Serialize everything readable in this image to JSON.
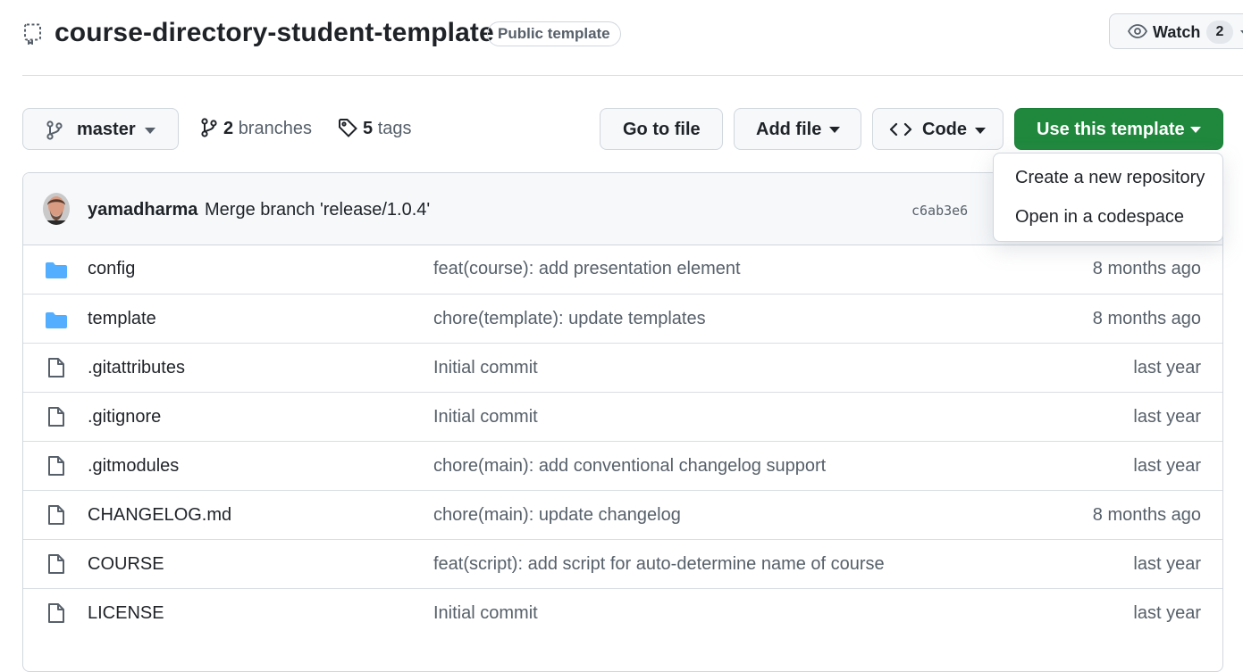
{
  "header": {
    "repo_name": "course-directory-student-template",
    "visibility_badge": "Public template",
    "watch_label": "Watch",
    "watch_count": "2"
  },
  "toolbar": {
    "branch": "master",
    "branches_count": "2",
    "branches_label": "branches",
    "tags_count": "5",
    "tags_label": "tags",
    "go_to_file": "Go to file",
    "add_file": "Add file",
    "code": "Code",
    "use_template": "Use this template"
  },
  "template_menu": {
    "items": [
      "Create a new repository",
      "Open in a codespace"
    ]
  },
  "latest_commit": {
    "author": "yamadharma",
    "message": "Merge branch 'release/1.0.4'",
    "sha": "c6ab3e6"
  },
  "files": [
    {
      "name": "config",
      "type": "folder",
      "message": "feat(course): add presentation element",
      "age": "8 months ago"
    },
    {
      "name": "template",
      "type": "folder",
      "message": "chore(template): update templates",
      "age": "8 months ago"
    },
    {
      "name": ".gitattributes",
      "type": "file",
      "message": "Initial commit",
      "age": "last year"
    },
    {
      "name": ".gitignore",
      "type": "file",
      "message": "Initial commit",
      "age": "last year"
    },
    {
      "name": ".gitmodules",
      "type": "file",
      "message": "chore(main): add conventional changelog support",
      "age": "last year"
    },
    {
      "name": "CHANGELOG.md",
      "type": "file",
      "message": "chore(main): update changelog",
      "age": "8 months ago"
    },
    {
      "name": "COURSE",
      "type": "file",
      "message": "feat(script): add script for auto-determine name of course",
      "age": "last year"
    },
    {
      "name": "LICENSE",
      "type": "file",
      "message": "Initial commit",
      "age": "last year"
    }
  ],
  "colors": {
    "accent_green": "#1f883d",
    "folder_blue": "#54aeff",
    "muted_text": "#57606a"
  }
}
